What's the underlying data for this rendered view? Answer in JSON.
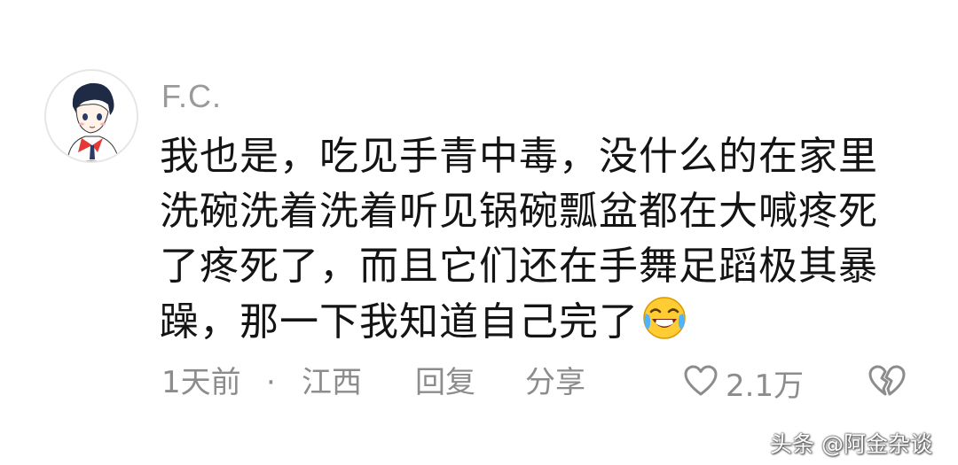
{
  "comment": {
    "username": "F.C.",
    "avatar_icon": "cartoon-boy-avatar-icon",
    "text_lines": [
      "我也是，吃见手青中毒，没什么的在家里",
      "洗碗洗着洗着听见锅碗瓢盆都在大喊疼死",
      "了疼死了，而且它们还在手舞足蹈极其暴",
      "躁，那一下我知道自己完了"
    ],
    "emoji_icon": "laughing-crying-emoji-icon",
    "time": "1天前",
    "separator": "·",
    "location": "江西",
    "reply_label": "回复",
    "share_label": "分享",
    "like_icon": "heart-outline-icon",
    "like_count": "2.1万",
    "dislike_icon": "broken-heart-icon"
  },
  "watermark": "头条 @阿金杂谈",
  "colors": {
    "text": "#141414",
    "muted": "#8c8c8c",
    "username": "#9a9a9a",
    "background": "#ffffff"
  }
}
